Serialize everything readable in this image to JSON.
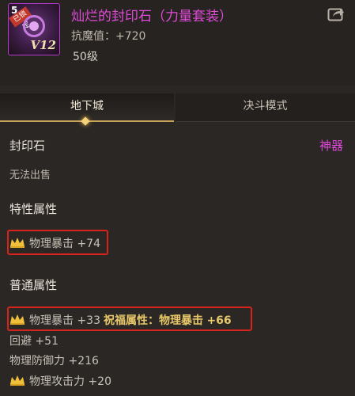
{
  "item": {
    "stack_count": "5",
    "lock_tag": "已锁定",
    "level_badge": "V12",
    "name": "灿烂的封印石（力量套装）",
    "resist": "抗魔值：+720",
    "level": "50级"
  },
  "tabs": [
    {
      "label": "地下城",
      "active": true
    },
    {
      "label": "决斗模式",
      "active": false
    }
  ],
  "info": {
    "type": "封印石",
    "grade": "神器",
    "sell_note": "无法出售"
  },
  "sections": {
    "special_title": "特性属性",
    "special_attr": "物理暴击 +74",
    "normal_title": "普通属性",
    "normal_attr1": "物理暴击 +33",
    "bless_label": "祝福属性：物理暴击",
    "bless_value": "+66",
    "evasion": "回避 +51",
    "phys_def": "物理防御力 +216",
    "phys_atk": "物理攻击力 +20"
  },
  "colors": {
    "epic_name": "#e04ad8",
    "highlight_box": "#d8231c",
    "crown": "#f0c03a"
  }
}
